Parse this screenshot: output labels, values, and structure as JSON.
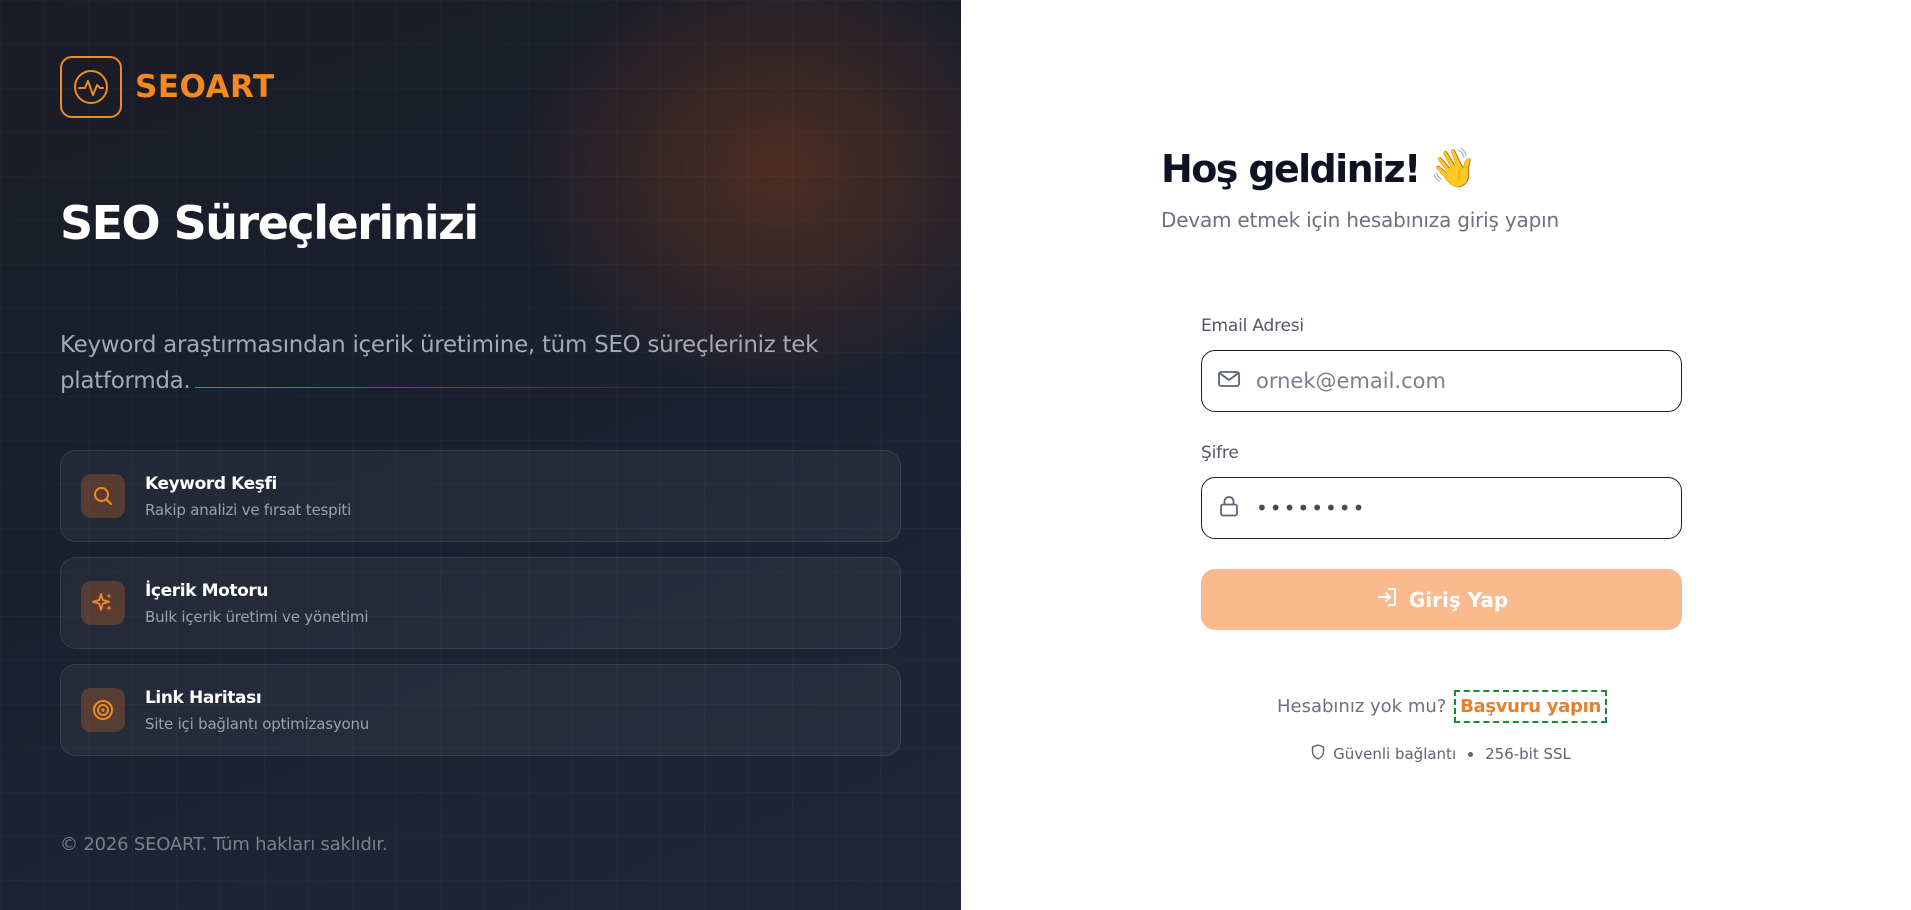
{
  "brand": {
    "name": "SEOART",
    "logo_icon": "pulse-icon",
    "accent_color": "#f5891f"
  },
  "hero": {
    "title": "SEO Süreçlerinizi",
    "description": "Keyword araştırmasından içerik üretimine, tüm SEO süreçleriniz tek platformda."
  },
  "features": [
    {
      "icon": "search-icon",
      "title": "Keyword Keşfi",
      "subtitle": "Rakip analizi ve fırsat tespiti"
    },
    {
      "icon": "sparkles-icon",
      "title": "İçerik Motoru",
      "subtitle": "Bulk içerik üretimi ve yönetimi"
    },
    {
      "icon": "target-icon",
      "title": "Link Haritası",
      "subtitle": "Site içi bağlantı optimizasyonu"
    }
  ],
  "footer": {
    "copyright": "© 2026 SEOART. Tüm hakları saklıdır."
  },
  "login": {
    "welcome": "Hoş geldiniz!",
    "welcome_emoji": "👋",
    "subtitle": "Devam etmek için hesabınıza giriş yapın",
    "email_label": "Email Adresi",
    "email_placeholder": "ornek@email.com",
    "password_label": "Şifre",
    "password_value": "••••••••",
    "submit_label": "Giriş Yap",
    "submit_color": "#fbb98e",
    "no_account_text": "Hesabınız yok mu?",
    "signup_link": "Başvuru yapın",
    "secure_text": "Güvenli bağlantı",
    "ssl_text": "256-bit SSL"
  }
}
